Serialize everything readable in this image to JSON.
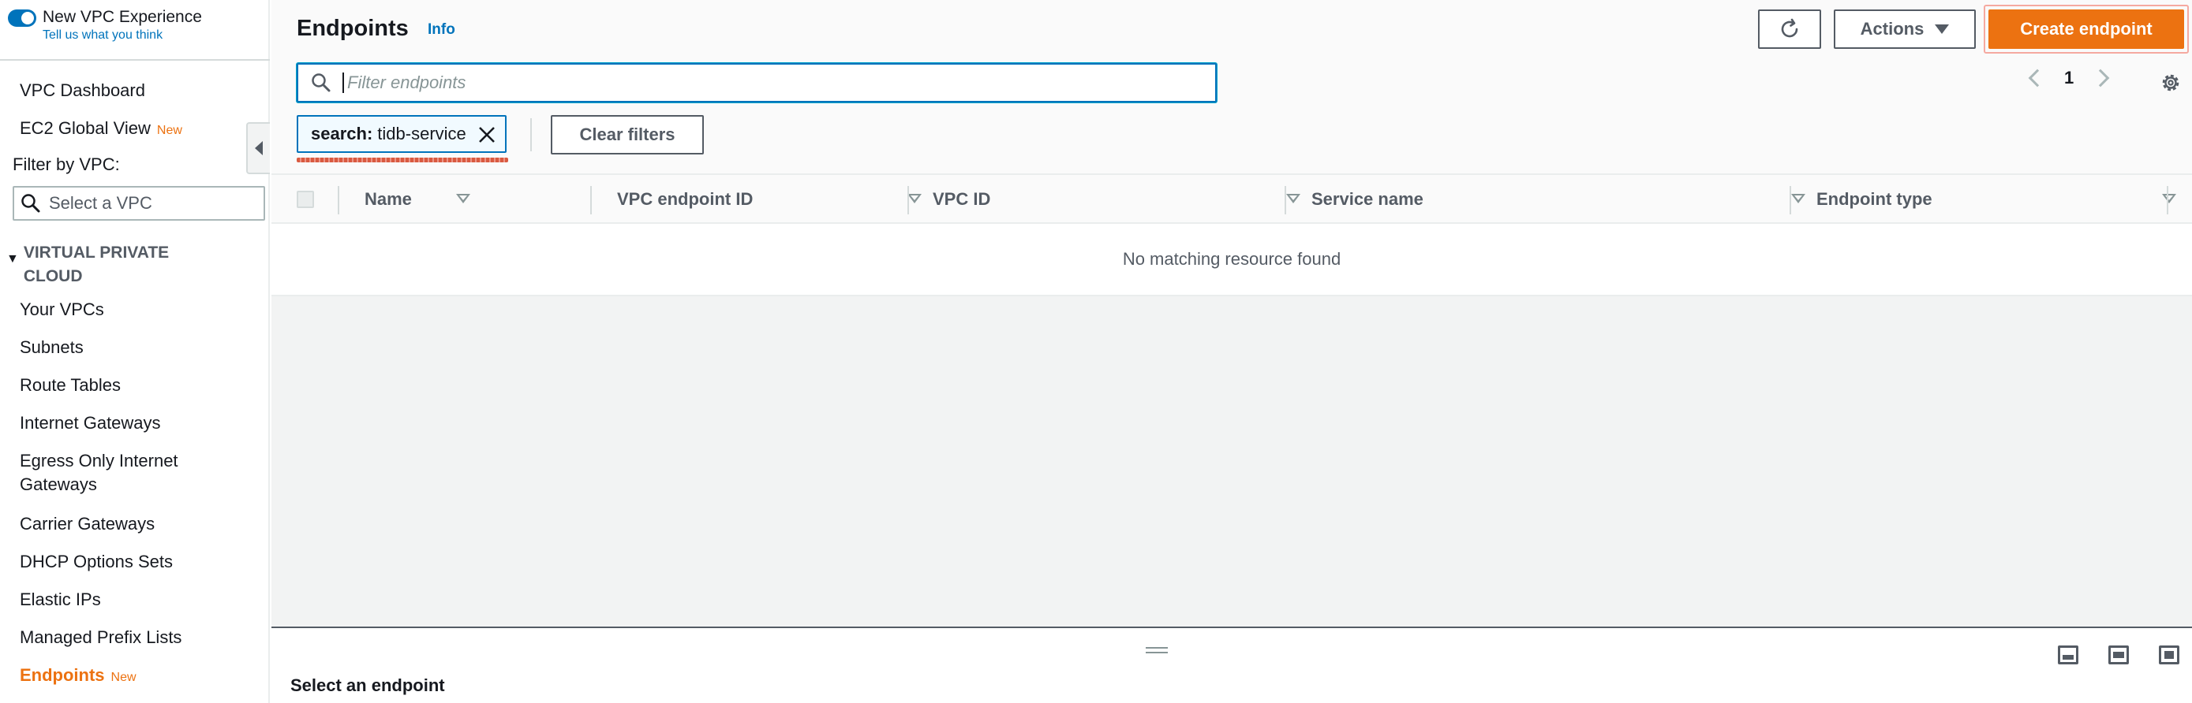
{
  "sidebar": {
    "toggle_label": "New VPC Experience",
    "feedback_link": "Tell us what you think",
    "items_top": [
      {
        "label": "VPC Dashboard",
        "badge": ""
      },
      {
        "label": "EC2 Global View",
        "badge": "New"
      }
    ],
    "filter_label": "Filter by VPC:",
    "vpc_select_placeholder": "Select a VPC",
    "section_title": "VIRTUAL PRIVATE CLOUD",
    "items": [
      {
        "label": "Your VPCs"
      },
      {
        "label": "Subnets"
      },
      {
        "label": "Route Tables"
      },
      {
        "label": "Internet Gateways"
      },
      {
        "label": "Egress Only Internet Gateways"
      },
      {
        "label": "Carrier Gateways"
      },
      {
        "label": "DHCP Options Sets"
      },
      {
        "label": "Elastic IPs"
      },
      {
        "label": "Managed Prefix Lists"
      },
      {
        "label": "Endpoints",
        "badge": "New"
      }
    ]
  },
  "header": {
    "title": "Endpoints",
    "info": "Info",
    "actions_label": "Actions",
    "create_label": "Create endpoint"
  },
  "search": {
    "placeholder": "Filter endpoints",
    "value": ""
  },
  "filter_token": {
    "key": "search:",
    "value": "tidb-service"
  },
  "clear_filters_label": "Clear filters",
  "pagination": {
    "current_page": "1"
  },
  "table": {
    "columns": [
      "Name",
      "VPC endpoint ID",
      "VPC ID",
      "Service name",
      "Endpoint type"
    ],
    "empty_message": "No matching resource found"
  },
  "split_panel": {
    "title": "Select an endpoint"
  },
  "colors": {
    "accent": "#ec7211",
    "link": "#0073bb",
    "text": "#16191f"
  }
}
